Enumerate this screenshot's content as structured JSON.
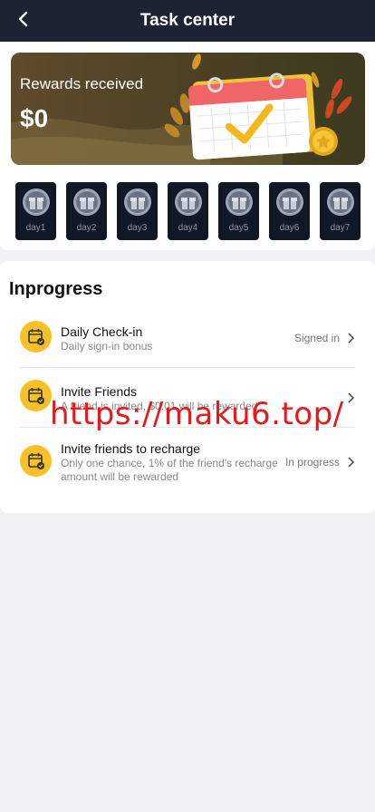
{
  "header": {
    "title": "Task center",
    "back_icon": "chevron-left-icon"
  },
  "rewards": {
    "label": "Rewards received",
    "amount": "$0"
  },
  "checkin_days": [
    {
      "label": "day1"
    },
    {
      "label": "day2"
    },
    {
      "label": "day3"
    },
    {
      "label": "day4"
    },
    {
      "label": "day5"
    },
    {
      "label": "day6"
    },
    {
      "label": "day7"
    }
  ],
  "section": {
    "title": "Inprogress"
  },
  "tasks": [
    {
      "name": "Daily Check-in",
      "desc": "Daily sign-in bonus",
      "status": "Signed in",
      "icon": "calendar-check-icon"
    },
    {
      "name": "Invite Friends",
      "desc": "A friend is invited, $0.01 will be rewarded",
      "status": "",
      "icon": "calendar-check-icon"
    },
    {
      "name": "Invite friends to recharge",
      "desc": "Only one chance, 1% of the friend's recharge amount will be rewarded",
      "status": "In progress",
      "icon": "calendar-check-icon"
    }
  ],
  "watermark": "https://maku6.top/",
  "colors": {
    "header_bg": "#1c2433",
    "accent_yellow": "#f7c026",
    "day_tile_bg": "#101827",
    "watermark": "#e8171b"
  }
}
